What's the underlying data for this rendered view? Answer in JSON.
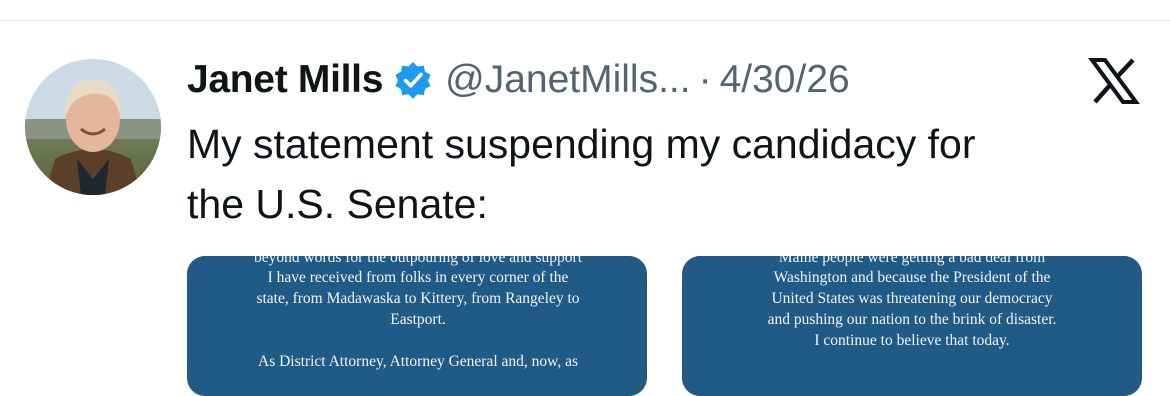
{
  "tweet": {
    "author_name": "Janet Mills",
    "handle": "@JanetMills...",
    "separator": "·",
    "date": "4/30/26",
    "text_line1": "My statement suspending my candidacy for",
    "text_line2": "the U.S. Senate:"
  },
  "icons": {
    "verified": "verified-badge-icon",
    "platform": "x-logo-icon"
  },
  "colors": {
    "verified_blue": "#1d9bf0",
    "secondary_text": "#536471",
    "primary_text": "#0f1419",
    "media_blue": "#1f5b86"
  },
  "media": {
    "left": {
      "cut_line": "beyond words for the outpouring of love and support",
      "lines": [
        "I have received from folks in every corner of the",
        "state, from Madawaska to Kittery, from Rangeley to",
        "Eastport.",
        "",
        "As District Attorney, Attorney General and, now, as"
      ]
    },
    "right": {
      "cut_line": "Maine people were getting a bad deal from",
      "lines": [
        "Washington and because the President of the",
        "United States was threatening our democracy",
        "and pushing our nation to the brink of disaster.",
        "I continue to believe that today."
      ]
    }
  }
}
